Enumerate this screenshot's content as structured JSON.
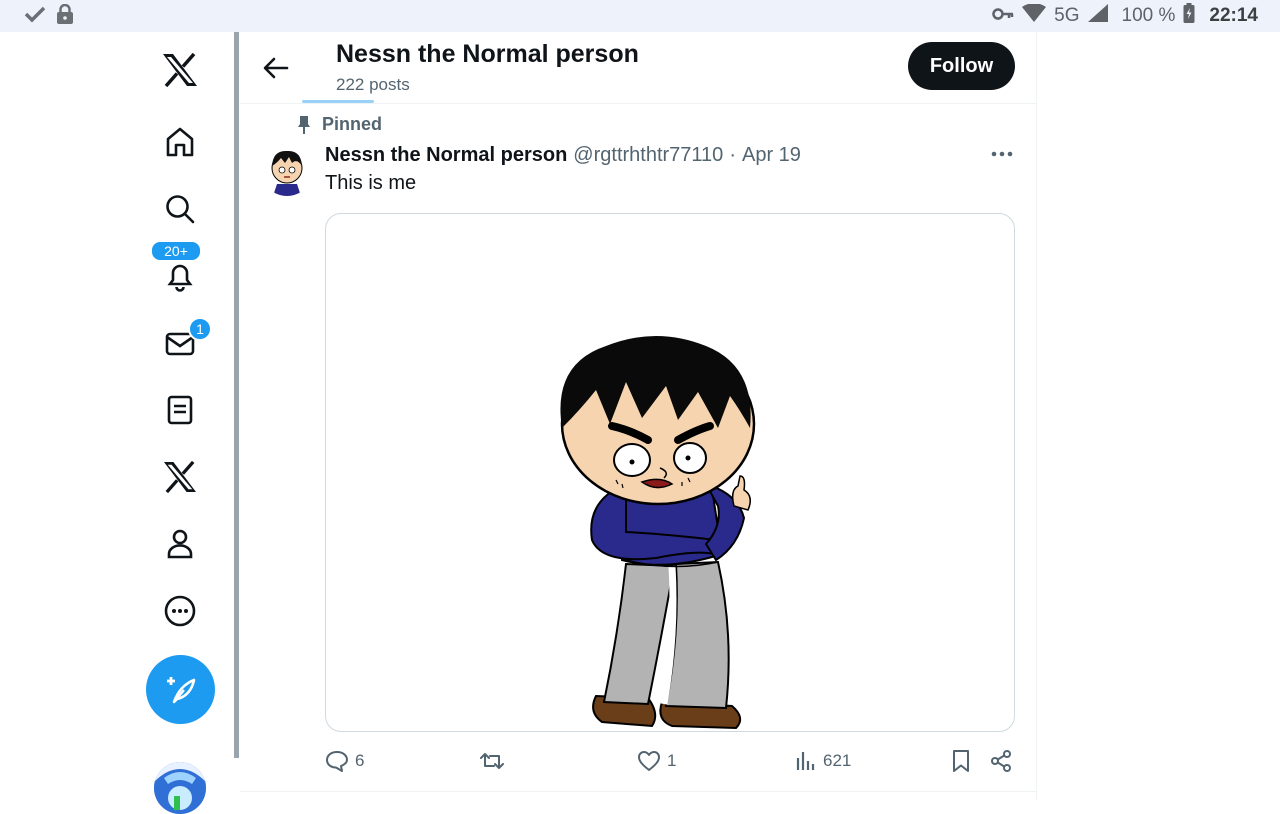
{
  "status_bar": {
    "network": "5G",
    "battery": "100 %",
    "time": "22:14"
  },
  "nav": {
    "notifications_badge": "20+",
    "messages_badge": "1"
  },
  "header": {
    "title": "Nessn the Normal person",
    "subtitle": "222 posts",
    "follow_label": "Follow"
  },
  "post": {
    "pinned_label": "Pinned",
    "author_name": "Nessn the Normal person",
    "author_handle": "@rgttrhthtr77110",
    "separator": "·",
    "date": "Apr 19",
    "text": "This is me",
    "replies": "6",
    "likes": "1",
    "views": "621"
  },
  "colors": {
    "accent": "#1d9bf0",
    "text_primary": "#0f1419",
    "text_secondary": "#536471",
    "follow_bg": "#0f1419"
  }
}
